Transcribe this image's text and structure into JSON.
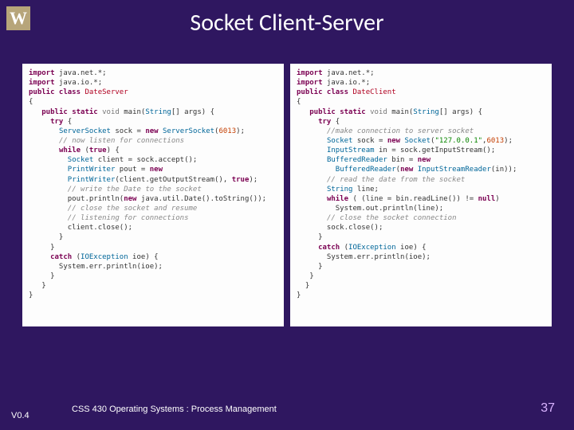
{
  "logo": "W",
  "title": "Socket Client-Server",
  "footer": {
    "version": "V0.4",
    "text": "CSS 430 Operating Systems : Process Management",
    "page": "37"
  },
  "server": {
    "lines": [
      [
        [
          "kw-import",
          "import"
        ],
        [
          "punct",
          " java.net."
        ],
        [
          "punct",
          "*;"
        ]
      ],
      [
        [
          "kw-import",
          "import"
        ],
        [
          "punct",
          " java.io."
        ],
        [
          "punct",
          "*;"
        ]
      ],
      [
        [
          "kw",
          "public class "
        ],
        [
          "cls",
          "DateServer"
        ]
      ],
      [
        [
          "punct",
          "{"
        ]
      ],
      [
        [
          "punct",
          "   "
        ],
        [
          "kw",
          "public static "
        ],
        [
          "void",
          "void"
        ],
        [
          "punct",
          " main("
        ],
        [
          "type",
          "String"
        ],
        [
          "punct",
          "[] args) {"
        ]
      ],
      [
        [
          "punct",
          "     "
        ],
        [
          "kw",
          "try"
        ],
        [
          "punct",
          " {"
        ]
      ],
      [
        [
          "punct",
          "       "
        ],
        [
          "type",
          "ServerSocket"
        ],
        [
          "punct",
          " sock = "
        ],
        [
          "kw",
          "new"
        ],
        [
          "punct",
          " "
        ],
        [
          "type",
          "ServerSocket"
        ],
        [
          "punct",
          "("
        ],
        [
          "lit",
          "6013"
        ],
        [
          "punct",
          ");"
        ]
      ],
      [
        [
          "punct",
          "       "
        ],
        [
          "comment",
          "// now listen for connections"
        ]
      ],
      [
        [
          "punct",
          "       "
        ],
        [
          "kw",
          "while"
        ],
        [
          "punct",
          " ("
        ],
        [
          "bool",
          "true"
        ],
        [
          "punct",
          ") {"
        ]
      ],
      [
        [
          "punct",
          "         "
        ],
        [
          "type",
          "Socket"
        ],
        [
          "punct",
          " client = sock.accept();"
        ]
      ],
      [
        [
          "punct",
          "         "
        ],
        [
          "type",
          "PrintWriter"
        ],
        [
          "punct",
          " pout = "
        ],
        [
          "kw",
          "new"
        ]
      ],
      [
        [
          "punct",
          "         "
        ],
        [
          "type",
          "PrintWriter"
        ],
        [
          "punct",
          "(client.getOutputStream(), "
        ],
        [
          "bool",
          "true"
        ],
        [
          "punct",
          ");"
        ]
      ],
      [
        [
          "punct",
          "         "
        ],
        [
          "comment",
          "// write the Date to the socket"
        ]
      ],
      [
        [
          "punct",
          "         pout.println("
        ],
        [
          "kw",
          "new"
        ],
        [
          "punct",
          " java.util.Date().toString());"
        ]
      ],
      [
        [
          "punct",
          "         "
        ],
        [
          "comment",
          "// close the socket and resume"
        ]
      ],
      [
        [
          "punct",
          "         "
        ],
        [
          "comment",
          "// listening for connections"
        ]
      ],
      [
        [
          "punct",
          "         client.close();"
        ]
      ],
      [
        [
          "punct",
          "       }"
        ]
      ],
      [
        [
          "punct",
          "     }"
        ]
      ],
      [
        [
          "punct",
          "     "
        ],
        [
          "kw",
          "catch"
        ],
        [
          "punct",
          " ("
        ],
        [
          "type",
          "IOException"
        ],
        [
          "punct",
          " ioe) {"
        ]
      ],
      [
        [
          "punct",
          "       System.err.println(ioe);"
        ]
      ],
      [
        [
          "punct",
          "     }"
        ]
      ],
      [
        [
          "punct",
          "   }"
        ]
      ],
      [
        [
          "punct",
          "}"
        ]
      ]
    ]
  },
  "client": {
    "lines": [
      [
        [
          "kw-import",
          "import"
        ],
        [
          "punct",
          " java.net."
        ],
        [
          "punct",
          "*;"
        ]
      ],
      [
        [
          "kw-import",
          "import"
        ],
        [
          "punct",
          " java.io."
        ],
        [
          "punct",
          "*;"
        ]
      ],
      [
        [
          "kw",
          "public class "
        ],
        [
          "cls",
          "DateClient"
        ]
      ],
      [
        [
          "punct",
          "{"
        ]
      ],
      [
        [
          "punct",
          "   "
        ],
        [
          "kw",
          "public static "
        ],
        [
          "void",
          "void"
        ],
        [
          "punct",
          " main("
        ],
        [
          "type",
          "String"
        ],
        [
          "punct",
          "[] args) {"
        ]
      ],
      [
        [
          "punct",
          "     "
        ],
        [
          "kw",
          "try"
        ],
        [
          "punct",
          " {"
        ]
      ],
      [
        [
          "punct",
          "       "
        ],
        [
          "comment",
          "//make connection to server socket"
        ]
      ],
      [
        [
          "punct",
          "       "
        ],
        [
          "type",
          "Socket"
        ],
        [
          "punct",
          " sock = "
        ],
        [
          "kw",
          "new"
        ],
        [
          "punct",
          " "
        ],
        [
          "type",
          "Socket"
        ],
        [
          "punct",
          "("
        ],
        [
          "str",
          "\"127.0.0.1\""
        ],
        [
          "punct",
          ","
        ],
        [
          "lit",
          "6013"
        ],
        [
          "punct",
          ");"
        ]
      ],
      [
        [
          "punct",
          "       "
        ],
        [
          "type",
          "InputStream"
        ],
        [
          "punct",
          " in = sock.getInputStream();"
        ]
      ],
      [
        [
          "punct",
          "       "
        ],
        [
          "type",
          "BufferedReader"
        ],
        [
          "punct",
          " bin = "
        ],
        [
          "kw",
          "new"
        ]
      ],
      [
        [
          "punct",
          "         "
        ],
        [
          "type",
          "BufferedReader"
        ],
        [
          "punct",
          "("
        ],
        [
          "kw",
          "new"
        ],
        [
          "punct",
          " "
        ],
        [
          "type",
          "InputStreamReader"
        ],
        [
          "punct",
          "(in));"
        ]
      ],
      [
        [
          "punct",
          "       "
        ],
        [
          "comment",
          "// read the date from the socket"
        ]
      ],
      [
        [
          "punct",
          "       "
        ],
        [
          "type",
          "String"
        ],
        [
          "punct",
          " line;"
        ]
      ],
      [
        [
          "punct",
          "       "
        ],
        [
          "kw",
          "while"
        ],
        [
          "punct",
          " ( (line = bin.readLine()) != "
        ],
        [
          "null",
          "null"
        ],
        [
          "punct",
          ")"
        ]
      ],
      [
        [
          "punct",
          "         System.out.println(line);"
        ]
      ],
      [
        [
          "punct",
          "       "
        ],
        [
          "comment",
          "// close the socket connection"
        ]
      ],
      [
        [
          "punct",
          "       sock.close();"
        ]
      ],
      [
        [
          "punct",
          "     }"
        ]
      ],
      [
        [
          "punct",
          "     "
        ],
        [
          "kw",
          "catch"
        ],
        [
          "punct",
          " ("
        ],
        [
          "type",
          "IOException"
        ],
        [
          "punct",
          " ioe) {"
        ]
      ],
      [
        [
          "punct",
          "       System.err.println(ioe);"
        ]
      ],
      [
        [
          "punct",
          "     }"
        ]
      ],
      [
        [
          "punct",
          "   }"
        ]
      ],
      [
        [
          "punct",
          "  }"
        ]
      ],
      [
        [
          "punct",
          "}"
        ]
      ]
    ]
  }
}
